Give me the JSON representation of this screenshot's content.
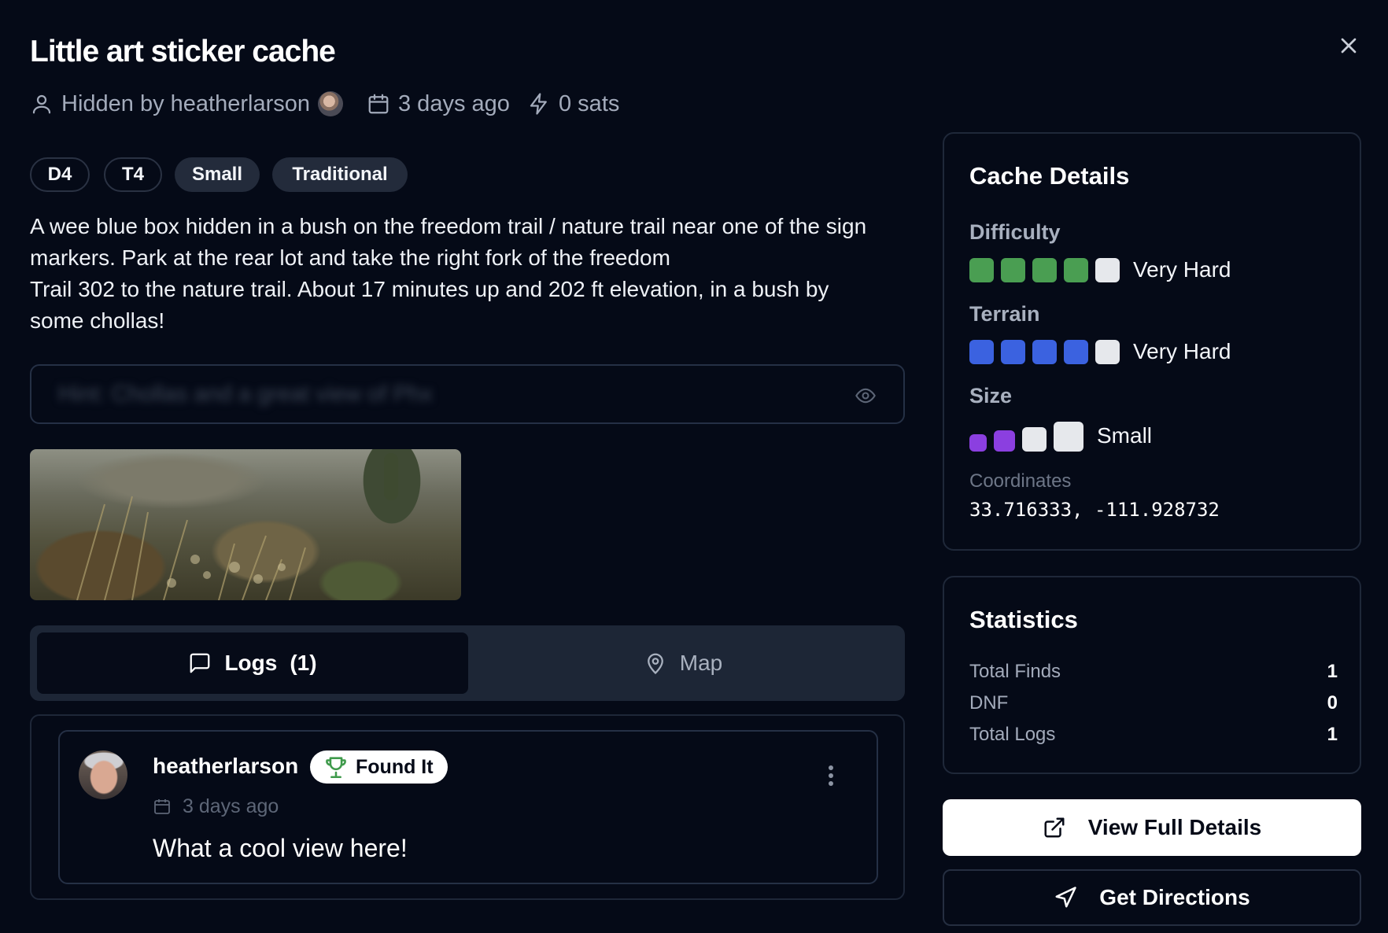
{
  "header": {
    "title": "Little art sticker cache",
    "hidden_by": "Hidden by heatherlarson",
    "date": "3 days ago",
    "sats": "0 sats"
  },
  "badges": {
    "difficulty": "D4",
    "terrain": "T4",
    "size": "Small",
    "type": "Traditional"
  },
  "description": {
    "line1": "A wee blue box hidden in a bush on the freedom trail / nature trail near one of the sign",
    "line2": "markers. Park at the rear lot and take the right fork of the freedom",
    "line3": "Trail 302 to the nature trail. About 17 minutes up and 202 ft elevation, in a bush by",
    "line4": "some chollas!"
  },
  "hint": {
    "label": "Hint:",
    "text": "Chollas and a great view of Phx"
  },
  "tabs": {
    "logs_label": "Logs",
    "logs_count": "(1)",
    "map_label": "Map"
  },
  "log": {
    "user": "heatherlarson",
    "type": "Found It",
    "date": "3 days ago",
    "text": "What a cool view here!"
  },
  "cache_details": {
    "title": "Cache Details",
    "difficulty_label": "Difficulty",
    "difficulty_value": 4,
    "difficulty_max": 5,
    "difficulty_text": "Very Hard",
    "terrain_label": "Terrain",
    "terrain_value": 4,
    "terrain_max": 5,
    "terrain_text": "Very Hard",
    "size_label": "Size",
    "size_value": 2,
    "size_max": 4,
    "size_text": "Small",
    "coords_label": "Coordinates",
    "coords": "33.716333, -111.928732"
  },
  "statistics": {
    "title": "Statistics",
    "rows": [
      {
        "label": "Total Finds",
        "value": "1"
      },
      {
        "label": "DNF",
        "value": "0"
      },
      {
        "label": "Total Logs",
        "value": "1"
      }
    ]
  },
  "buttons": {
    "view_details": "View Full Details",
    "directions": "Get Directions"
  },
  "colors": {
    "difficulty_on": "#4a9e52",
    "terrain_on": "#3b62e0",
    "size_on": "#8b3fe0",
    "off": "#e6e8ec",
    "found_icon": "#3f9a4b"
  },
  "icons": [
    "close-icon",
    "user-icon",
    "calendar-icon",
    "zap-icon",
    "eye-icon",
    "message-square-icon",
    "map-pin-icon",
    "trophy-icon",
    "more-vertical-icon",
    "external-link-icon",
    "navigation-icon"
  ]
}
